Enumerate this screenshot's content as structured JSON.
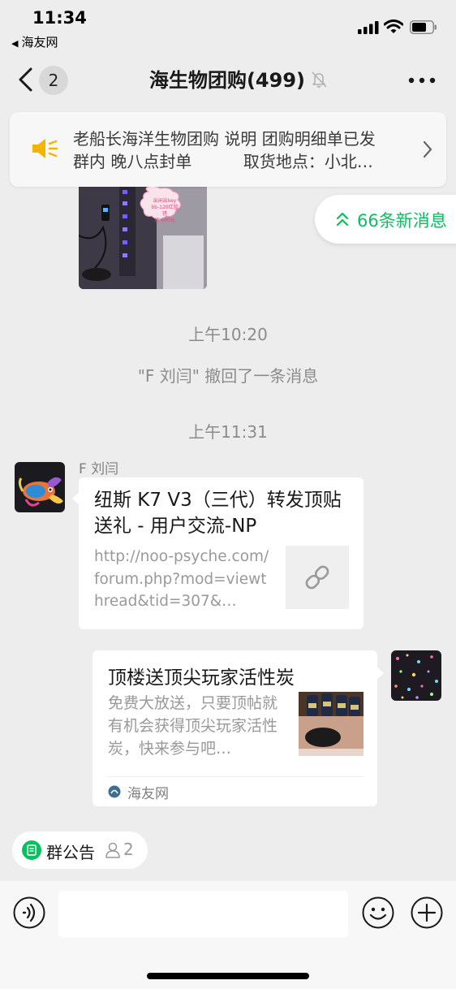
{
  "status_bar": {
    "time": "11:34",
    "back_app": "海友网",
    "icons": [
      "signal-icon",
      "wifi-icon",
      "battery-icon"
    ]
  },
  "nav": {
    "back_icon": "chevron-left-icon",
    "unread_count": "2",
    "title": "海生物团购(499)",
    "mute_icon": "bell-muted-icon",
    "more_icon": "ellipsis-icon"
  },
  "announcement": {
    "icon": "speaker-icon",
    "line1": "老船长海洋生物团购 说明 团购明细单已发",
    "line2": "群内 晚八点封单          取货地点：小北…",
    "chevron_icon": "chevron-right-icon"
  },
  "new_messages": {
    "icon": "double-chevron-up-icon",
    "label": "66条新消息"
  },
  "image_message": {
    "sticker_lines": [
      "出闲出key",
      "bb-120红蓝",
      "锈",
      "灯 600元"
    ]
  },
  "timeline": [
    {
      "type": "time",
      "text": "上午10:20"
    },
    {
      "type": "recall",
      "text": "\"F 刘闫\" 撤回了一条消息"
    },
    {
      "type": "time",
      "text": "上午11:31"
    }
  ],
  "link_message": {
    "sender": "F 刘闫",
    "title": "纽斯 K7 V3（三代）转发顶贴送礼 - 用户交流-NP",
    "url": "http://noo-psyche.com/forum.php?mod=viewthread&tid=307&…",
    "thumb_icon": "link-icon"
  },
  "miniprogram_message": {
    "title": "顶楼送顶尖玩家活性炭",
    "description": "免费大放送，只要顶帖就有机会获得顶尖玩家活性炭，快来参与吧…",
    "source": "海友网",
    "source_icon": "miniprogram-icon"
  },
  "group_notice": {
    "icon": "notice-icon",
    "label": "群公告",
    "person_icon": "person-icon",
    "count": "2"
  },
  "input_bar": {
    "voice_icon": "voice-icon",
    "emoji_icon": "emoji-icon",
    "plus_icon": "plus-icon",
    "placeholder": ""
  },
  "colors": {
    "accent_green": "#07c160",
    "background": "#ededed",
    "speaker_yellow": "#f5b400"
  }
}
